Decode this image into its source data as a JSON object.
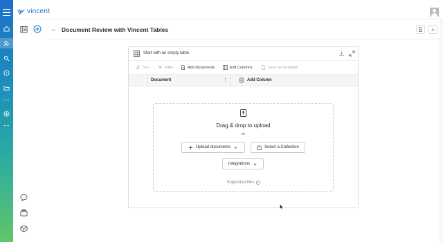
{
  "app": {
    "brand_name": "vincent",
    "brand_color": "#1a6fd1"
  },
  "rail": {
    "items": [
      {
        "icon": "menu-icon"
      },
      {
        "icon": "home-icon"
      },
      {
        "icon": "users-icon"
      },
      {
        "icon": "search-icon"
      },
      {
        "icon": "compass-icon"
      },
      {
        "icon": "folder-icon"
      },
      {
        "icon": "more-icon"
      },
      {
        "icon": "dollar-icon"
      },
      {
        "icon": "more-icon"
      }
    ],
    "gradient": [
      "#1f6fc9",
      "#1c93b8",
      "#31b09a",
      "#63c56b"
    ]
  },
  "page": {
    "back_glyph": "←",
    "title": "Document Review with Vincent Tables"
  },
  "left_dock": {
    "icons": [
      "chat-icon",
      "stack-icon",
      "cube-icon"
    ]
  },
  "table_card": {
    "start_label": "Start with an empty table",
    "toolbar": {
      "sort": "Sort",
      "filter": "Filter",
      "add_documents": "Add Documents",
      "edit_columns": "Edit Columns",
      "save_template": "Save as Template"
    },
    "columns": {
      "document": "Document",
      "kebab": "⋮",
      "add_column": "Add Column"
    },
    "dropzone": {
      "headline": "Drag & drop to upload",
      "or": "or",
      "upload_button": "Upload documents",
      "collection_button": "Select a Collection",
      "integrations_button": "Integrations",
      "supported": "Supported files",
      "info_glyph": "i"
    }
  }
}
